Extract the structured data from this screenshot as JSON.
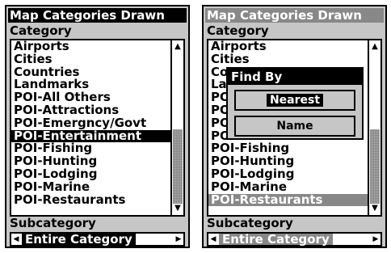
{
  "left_screen": {
    "title": "Map Categories Drawn",
    "category_label": "Category",
    "items": [
      {
        "label": "Airports"
      },
      {
        "label": "Cities"
      },
      {
        "label": "Countries"
      },
      {
        "label": "Landmarks"
      },
      {
        "label": "POI-All Others"
      },
      {
        "label": "POI-Attractions"
      },
      {
        "label": "POI-Emergncy/Govt"
      },
      {
        "label": "POI-Entertainment"
      },
      {
        "label": "POI-Fishing"
      },
      {
        "label": "POI-Hunting"
      },
      {
        "label": "POI-Lodging"
      },
      {
        "label": "POI-Marine"
      },
      {
        "label": "POI-Restaurants"
      }
    ],
    "selected_item": "POI-Entertainment",
    "subcategory_label": "Subcategory",
    "subcategory_value": "Entire Category"
  },
  "right_screen": {
    "title": "Map Categories Drawn",
    "category_label": "Category",
    "items": [
      {
        "label": "Airports"
      },
      {
        "label": "Cities"
      },
      {
        "label": "Co"
      },
      {
        "label": "La"
      },
      {
        "label": "PO"
      },
      {
        "label": "PO"
      },
      {
        "label": "PO"
      },
      {
        "label": "PO"
      },
      {
        "label": "POI-Fishing"
      },
      {
        "label": "POI-Hunting"
      },
      {
        "label": "POI-Lodging"
      },
      {
        "label": "POI-Marine"
      },
      {
        "label": "POI-Restaurants"
      }
    ],
    "selected_item": "POI-Restaurants",
    "subcategory_label": "Subcategory",
    "subcategory_value": "Entire Category",
    "dialog": {
      "title": "Find By",
      "buttons": [
        "Nearest",
        "Name"
      ],
      "focused_button": "Nearest"
    }
  },
  "icons": {
    "scroll_up": "arrow-up-icon",
    "scroll_down": "arrow-down-icon",
    "selector_left": "arrow-left-icon",
    "selector_right": "arrow-right-icon"
  },
  "glyphs": {
    "up": "▲",
    "down": "▼",
    "left": "◀",
    "right": "▶"
  },
  "colors": {
    "screen_bg": "#c6c6c6",
    "list_bg": "#ffffff",
    "highlight_active": "#000000",
    "highlight_inactive": "#888888",
    "text": "#000000"
  }
}
